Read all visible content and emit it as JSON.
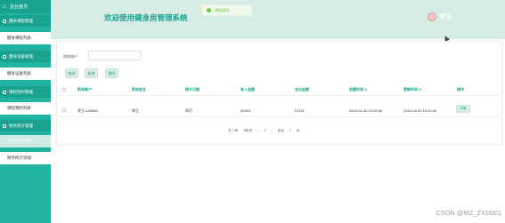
{
  "sidebar": {
    "home_icon": "home-icon",
    "home_label": "后台首页",
    "groups": [
      {
        "title": "健身课程管理",
        "item": "健身课程列表"
      },
      {
        "title": "健身设备管理",
        "item": "健身设备列表"
      },
      {
        "title": "课程预约管理",
        "item": "课程预约列表"
      },
      {
        "title": "财务统计管理",
        "item": "财务统计列表",
        "item2": "财务统计添加"
      }
    ]
  },
  "header": {
    "title": "欢迎使用健身房管理系统",
    "toast": "增加成功!",
    "user_name": "李玉",
    "accent": "#1aa290"
  },
  "search": {
    "label": "财务账户:",
    "value": ""
  },
  "buttons": {
    "search": "查询",
    "add": "新增",
    "delete": "删除"
  },
  "table": {
    "headers": [
      "财务账户",
      "财务姓名",
      "统计日期",
      "收入金额",
      "支出金额",
      "创建时间",
      "更新时间",
      "操作"
    ],
    "sort_mark": "≑",
    "row": {
      "account": "李玉-445566",
      "name": "李玉",
      "date": "四月",
      "income": "55454",
      "expense": "21114",
      "created": "2024-04-30 15:39:46",
      "updated": "2024-04-30 15:39:46",
      "action": "详情"
    }
  },
  "pagination": {
    "total": "共 1 条",
    "size": "7条/页",
    "prev": "‹",
    "page": "1",
    "next": "›",
    "goto": "前往",
    "goto_page": "1",
    "page_unit": "页"
  },
  "watermark": "CSDN @MZ_ZXD001"
}
